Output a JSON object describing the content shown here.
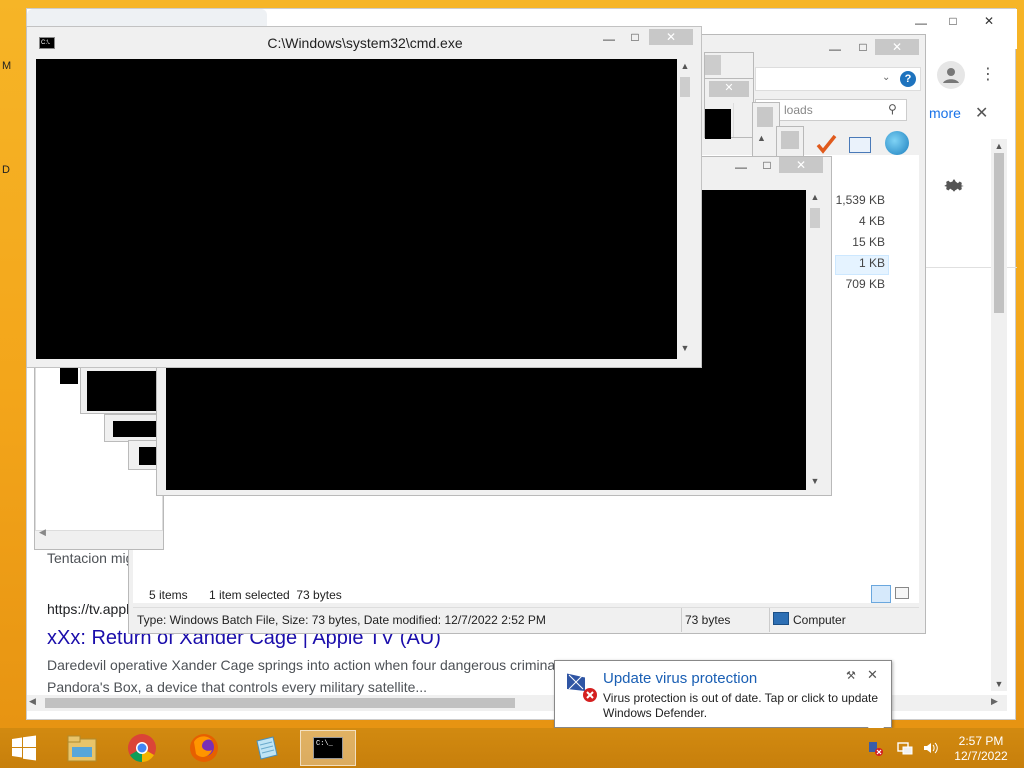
{
  "browser": {
    "more_label": "more",
    "snippet_partial": "Tentacion mig",
    "url_partial": "https://tv.appl",
    "result_title": "xXx: Return of Xander Cage | Apple TV (AU)",
    "result_desc_1": "Daredevil operative Xander Cage springs into action when four dangerous crimina",
    "result_desc_2": "Pandora's Box, a device that controls every military satellite..."
  },
  "cmd": {
    "title": "C:\\Windows\\system32\\cmd.exe",
    "icon_label": "C:\\."
  },
  "explorer": {
    "search_partial": "loads",
    "file_sizes": [
      "1,539 KB",
      "4 KB",
      "15 KB",
      "1 KB",
      "709 KB"
    ],
    "status_items": "5 items",
    "status_selected": "1 item selected  73 bytes",
    "details_info": "Type: Windows Batch File, Size: 73 bytes, Date modified: 12/7/2022 2:52 PM",
    "details_size": "73 bytes",
    "details_location": "Computer"
  },
  "notification": {
    "title": "Update virus protection",
    "body": "Virus protection is out of date. Tap or click to update Windows Defender."
  },
  "taskbar": {
    "time": "2:57 PM",
    "date": "12/7/2022",
    "cmd_icon_text": "C:\\_"
  },
  "desktop": {
    "edge_letter_1": "M",
    "edge_letter_2": "D"
  },
  "colors": {
    "desktop": "#f5a81e",
    "link": "#1a0dab",
    "notification_title": "#1a5fb4"
  }
}
